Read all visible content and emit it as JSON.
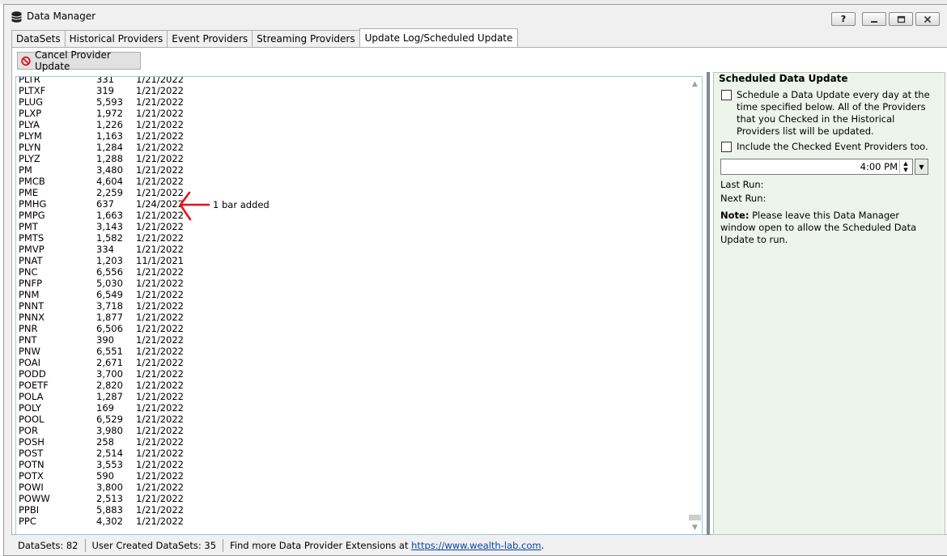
{
  "window": {
    "title": "Data Manager",
    "help_label": "?"
  },
  "tabs": [
    {
      "label": "DataSets",
      "active": false
    },
    {
      "label": "Historical Providers",
      "active": false
    },
    {
      "label": "Event Providers",
      "active": false
    },
    {
      "label": "Streaming Providers",
      "active": false
    },
    {
      "label": "Update Log/Scheduled Update",
      "active": true
    }
  ],
  "toolbar": {
    "cancel_label": "Cancel Provider Update",
    "cancel_icon": "no-entry-icon",
    "cancel_icon_color": "#e0141e"
  },
  "log": {
    "rows": [
      [
        "PLTR",
        "331",
        "1/21/2022"
      ],
      [
        "PLTXF",
        "319",
        "1/21/2022"
      ],
      [
        "PLUG",
        "5,593",
        "1/21/2022"
      ],
      [
        "PLXP",
        "1,972",
        "1/21/2022"
      ],
      [
        "PLYA",
        "1,226",
        "1/21/2022"
      ],
      [
        "PLYM",
        "1,163",
        "1/21/2022"
      ],
      [
        "PLYN",
        "1,284",
        "1/21/2022"
      ],
      [
        "PLYZ",
        "1,288",
        "1/21/2022"
      ],
      [
        "PM",
        "3,480",
        "1/21/2022"
      ],
      [
        "PMCB",
        "4,604",
        "1/21/2022"
      ],
      [
        "PME",
        "2,259",
        "1/21/2022"
      ],
      [
        "PMHG",
        "637",
        "1/24/2022"
      ],
      [
        "PMPG",
        "1,663",
        "1/21/2022"
      ],
      [
        "PMT",
        "3,143",
        "1/21/2022"
      ],
      [
        "PMTS",
        "1,582",
        "1/21/2022"
      ],
      [
        "PMVP",
        "334",
        "1/21/2022"
      ],
      [
        "PNAT",
        "1,203",
        "11/1/2021"
      ],
      [
        "PNC",
        "6,556",
        "1/21/2022"
      ],
      [
        "PNFP",
        "5,030",
        "1/21/2022"
      ],
      [
        "PNM",
        "6,549",
        "1/21/2022"
      ],
      [
        "PNNT",
        "3,718",
        "1/21/2022"
      ],
      [
        "PNNX",
        "1,877",
        "1/21/2022"
      ],
      [
        "PNR",
        "6,506",
        "1/21/2022"
      ],
      [
        "PNT",
        "390",
        "1/21/2022"
      ],
      [
        "PNW",
        "6,551",
        "1/21/2022"
      ],
      [
        "POAI",
        "2,671",
        "1/21/2022"
      ],
      [
        "PODD",
        "3,700",
        "1/21/2022"
      ],
      [
        "POETF",
        "2,820",
        "1/21/2022"
      ],
      [
        "POLA",
        "1,287",
        "1/21/2022"
      ],
      [
        "POLY",
        "169",
        "1/21/2022"
      ],
      [
        "POOL",
        "6,529",
        "1/21/2022"
      ],
      [
        "POR",
        "3,980",
        "1/21/2022"
      ],
      [
        "POSH",
        "258",
        "1/21/2022"
      ],
      [
        "POST",
        "2,514",
        "1/21/2022"
      ],
      [
        "POTN",
        "3,553",
        "1/21/2022"
      ],
      [
        "POTX",
        "590",
        "1/21/2022"
      ],
      [
        "POWI",
        "3,800",
        "1/21/2022"
      ],
      [
        "POWW",
        "2,513",
        "1/21/2022"
      ],
      [
        "PPBI",
        "5,883",
        "1/21/2022"
      ],
      [
        "PPC",
        "4,302",
        "1/21/2022"
      ]
    ],
    "annotation": "1 bar added",
    "annotation_color": "#e8101a"
  },
  "scheduled": {
    "title": "Scheduled Data Update",
    "schedule_label": "Schedule a Data Update every day at the time specified below. All of the Providers that you Checked in the Historical Providers list will be updated.",
    "schedule_checked": false,
    "include_events_label": "Include the Checked Event Providers too.",
    "include_events_checked": false,
    "time": "4:00 PM",
    "last_run_label": "Last Run:",
    "next_run_label": "Next Run:",
    "note_label": "Note:",
    "note_text": " Please leave this Data Manager window open to allow the Scheduled Data Update to run."
  },
  "status": {
    "datasets": "DataSets: 82",
    "user_datasets": "User Created DataSets: 35",
    "find_more": "Find more Data Provider Extensions at ",
    "link": "https://www.wealth-lab.com",
    "link_suffix": "."
  }
}
